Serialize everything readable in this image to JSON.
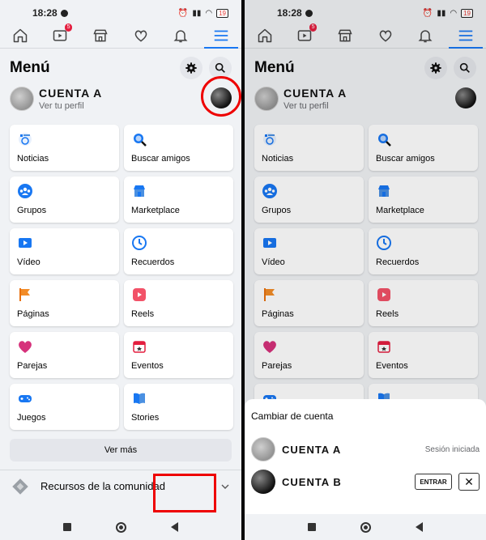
{
  "status": {
    "time": "18:28",
    "battery": "19"
  },
  "nav": {
    "video_badge": "5"
  },
  "header": {
    "title": "Menú"
  },
  "profile": {
    "name": "CUENTA A",
    "subtitle": "Ver tu perfil"
  },
  "cards": [
    {
      "label": "Noticias",
      "icon": "news-feed-icon"
    },
    {
      "label": "Buscar amigos",
      "icon": "find-friends-icon"
    },
    {
      "label": "Grupos",
      "icon": "groups-icon"
    },
    {
      "label": "Marketplace",
      "icon": "marketplace-icon"
    },
    {
      "label": "Vídeo",
      "icon": "video-icon"
    },
    {
      "label": "Recuerdos",
      "icon": "memories-icon"
    },
    {
      "label": "Páginas",
      "icon": "pages-flag-icon"
    },
    {
      "label": "Reels",
      "icon": "reels-icon"
    },
    {
      "label": "Parejas",
      "icon": "dating-heart-icon"
    },
    {
      "label": "Eventos",
      "icon": "events-calendar-icon"
    },
    {
      "label": "Juegos",
      "icon": "games-controller-icon"
    },
    {
      "label": "Stories",
      "icon": "stories-book-icon"
    }
  ],
  "ver_mas": "Ver más",
  "recursos": "Recursos de la comunidad",
  "sheet": {
    "title": "Cambiar de cuenta",
    "account_a": {
      "name": "CUENTA A",
      "state": "Sesión iniciada"
    },
    "account_b": {
      "name": "CUENTA B",
      "button": "ENTRAR"
    }
  },
  "colors": {
    "accent": "#1877f2",
    "highlight": "#e00000"
  }
}
